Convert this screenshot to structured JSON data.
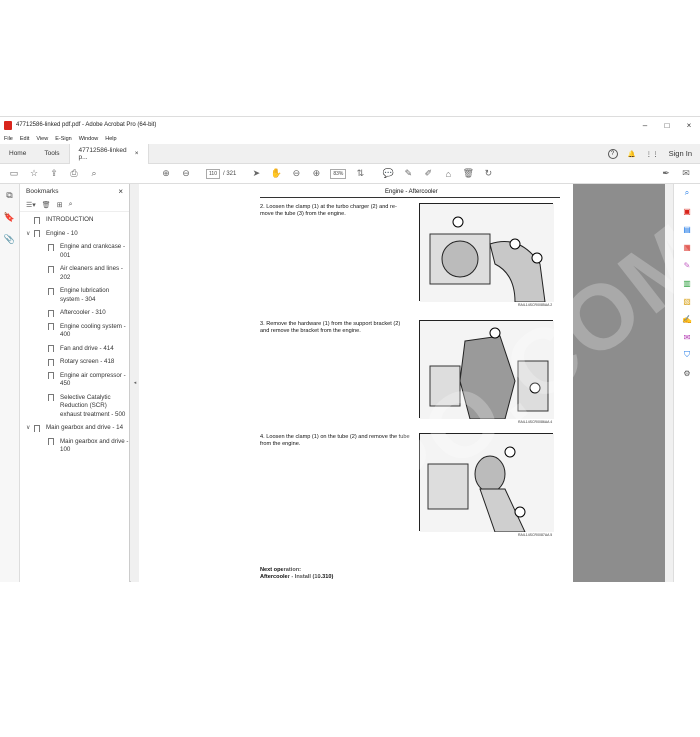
{
  "window": {
    "title": "47712586-linked pdf.pdf - Adobe Acrobat Pro (64-bit)"
  },
  "menu": [
    "File",
    "Edit",
    "View",
    "E-Sign",
    "Window",
    "Help"
  ],
  "tabs": {
    "home": "Home",
    "tools": "Tools",
    "doc": "47712586-linked p...",
    "close": "×"
  },
  "signin": "Sign In",
  "toolbar": {
    "page_current": "110",
    "page_total": "/ 321",
    "zoom": "83%"
  },
  "bookmarks": {
    "title": "Bookmarks",
    "items": [
      {
        "label": "INTRODUCTION",
        "level": 0,
        "chevron": ""
      },
      {
        "label": "Engine - 10",
        "level": 0,
        "chevron": "∨"
      },
      {
        "label": "Engine and crankcase - 001",
        "level": 1,
        "chevron": ""
      },
      {
        "label": "Air cleaners and lines - 202",
        "level": 1,
        "chevron": ""
      },
      {
        "label": "Engine lubrication system - 304",
        "level": 1,
        "chevron": ""
      },
      {
        "label": "Aftercooler - 310",
        "level": 1,
        "chevron": ""
      },
      {
        "label": "Engine cooling system - 400",
        "level": 1,
        "chevron": ""
      },
      {
        "label": "Fan and drive - 414",
        "level": 1,
        "chevron": ""
      },
      {
        "label": "Rotary screen - 418",
        "level": 1,
        "chevron": ""
      },
      {
        "label": "Engine air compressor - 450",
        "level": 1,
        "chevron": ""
      },
      {
        "label": "Selective Catalytic Reduction (SCR) exhaust treatment - 500",
        "level": 1,
        "chevron": ""
      },
      {
        "label": "Main gearbox and drive - 14",
        "level": 0,
        "chevron": "∨"
      },
      {
        "label": "Main gearbox and drive - 100",
        "level": 1,
        "chevron": ""
      }
    ]
  },
  "document": {
    "header": "Engine - Aftercooler",
    "steps": [
      {
        "text": "2.  Loosen the clamp (1) at the turbo charger (2) and re-move the tube (3) from the engine.",
        "caption": "RAIL14SCR0085AA     2"
      },
      {
        "text": "3.  Remove the hardware (1) from the support bracket (2) and remove the bracket from the engine.",
        "caption": "RAIL14SCR0086AA     4"
      },
      {
        "text": "4.  Loosen the clamp (1) on the tube (2) and remove the tube from the engine.",
        "caption": "RAIL14SCR0087AA     5"
      }
    ],
    "next_title": "Next operation:",
    "next_link": "Aftercooler - Install (10.310)"
  },
  "watermark": "EPCDEPO.COM"
}
